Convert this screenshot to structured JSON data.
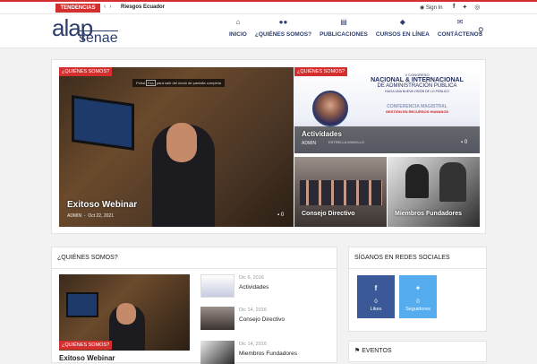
{
  "topbar": {
    "trending_label": "TENDENCIAS",
    "trending_text": "Riesgos Ecuador",
    "signin": "Sign In"
  },
  "logo": {
    "line1": "alap",
    "line2": "senae"
  },
  "nav": {
    "items": [
      {
        "label": "INICIO",
        "icon": "home-icon",
        "glyph": "⌂"
      },
      {
        "label": "¿QUIÉNES SOMOS?",
        "icon": "users-icon",
        "glyph": "👥"
      },
      {
        "label": "PUBLICACIONES",
        "icon": "newspaper-icon",
        "glyph": "▤"
      },
      {
        "label": "CURSOS EN LÍNEA",
        "icon": "cubes-icon",
        "glyph": "◆"
      },
      {
        "label": "CONTÁCTENOS",
        "icon": "envelope-icon",
        "glyph": "✉"
      }
    ]
  },
  "featured": {
    "main": {
      "category": "¿QUIÉNES SOMOS?",
      "title": "Exitoso Webinar",
      "author": "ADMIN",
      "date": "Oct 22, 2021",
      "comments": "0",
      "overlay_hint_pre": "Pulsa",
      "overlay_hint_key": "Esc",
      "overlay_hint_post": "para salir del modo de pantalla completa"
    },
    "top_right": {
      "category": "¿QUIÉNES SOMOS?",
      "title": "Actividades",
      "author": "ADMIN",
      "comments": "0",
      "banner_line1": "V CONGRESO",
      "banner_line2": "NACIONAL",
      "banner_amp": "&",
      "banner_line3": "INTERNACIONAL",
      "banner_line4": "DE ADMINISTRACIÓN PÚBLICA",
      "banner_line5": "HACIA UNA NUEVA VISIÓN DE LO PÚBLICO",
      "banner_conf": "CONFERENCIA MAGISTRAL",
      "banner_topic": "GESTIÓN EN RECURSOS HUMANOS",
      "banner_speaker": "ESTRELLA MINVILLO"
    },
    "bottom_left": {
      "title": "Consejo Directivo"
    },
    "bottom_right": {
      "title": "Miembros Fundadores"
    }
  },
  "quienes": {
    "heading": "¿QUIÉNES SOMOS?",
    "main_category": "¿QUIÉNES SOMOS?",
    "main_title": "Exitoso Webinar",
    "posts": [
      {
        "date": "Dic 6, 2016",
        "title": "Actividades"
      },
      {
        "date": "Dic 14, 2016",
        "title": "Consejo Directivo"
      },
      {
        "date": "Dic 14, 2016",
        "title": "Miembros Fundadores"
      }
    ]
  },
  "social": {
    "heading": "SÍGANOS EN REDES SOCIALES",
    "facebook": {
      "count": "0",
      "label": "Likes"
    },
    "twitter": {
      "count": "0",
      "label": "Seguidores"
    }
  },
  "events": {
    "heading": "EVENTOS"
  },
  "colors": {
    "accent": "#d32f2f",
    "brand": "#2d3e6d",
    "facebook": "#3b5998",
    "twitter": "#55acee"
  }
}
